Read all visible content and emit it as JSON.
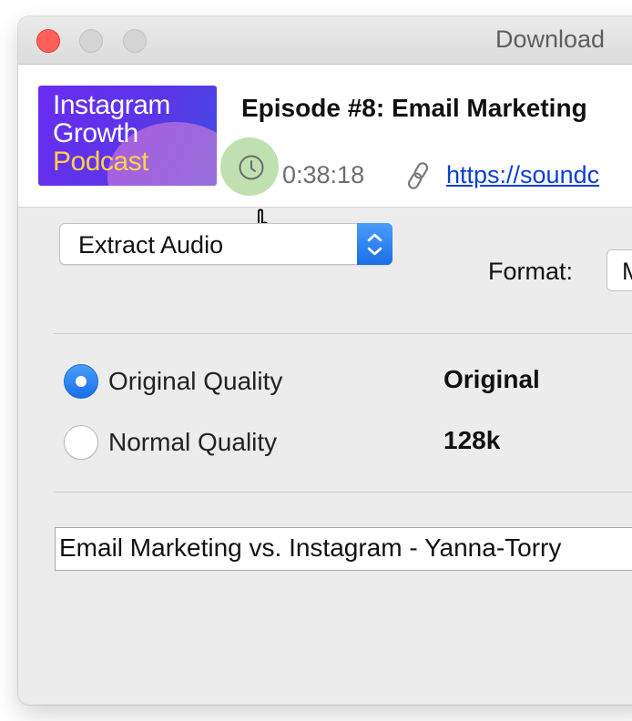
{
  "window": {
    "title": "Download"
  },
  "episode": {
    "thumbnail_lines": [
      "Instagram",
      "Growth",
      "Podcast"
    ],
    "title": "Episode #8: Email Marketing",
    "duration": "0:38:18",
    "url": "https://soundc"
  },
  "options": {
    "mode": "Extract Audio",
    "format_label": "Format:",
    "format_value": "M"
  },
  "quality": {
    "original_label": "Original Quality",
    "original_value": "Original",
    "normal_label": "Normal Quality",
    "normal_value": "128k",
    "selected": "original"
  },
  "filename": {
    "value": "Email Marketing vs. Instagram - Yanna-Torry"
  },
  "colors": {
    "accent": "#1a6fe8",
    "close_button": "#fe5f57",
    "thumbnail_purple": "#6a2cf0",
    "thumbnail_yellow": "#ffd24a",
    "link": "#0b3fd6"
  },
  "icons": {
    "duration": "clock-icon",
    "url": "link-icon",
    "pointer": "hand-cursor-icon"
  }
}
